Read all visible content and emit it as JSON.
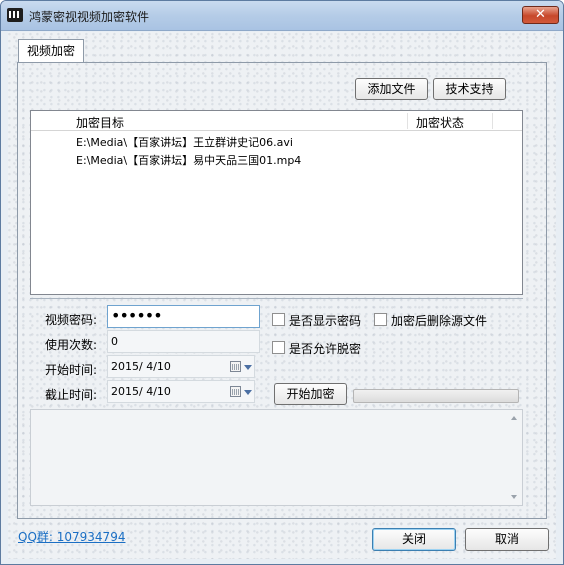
{
  "window": {
    "title": "鸿蒙密视视频加密软件",
    "close_glyph": "✕"
  },
  "tab": {
    "label": "视频加密"
  },
  "toolbar": {
    "add_file_label": "添加文件",
    "support_label": "技术支持"
  },
  "list": {
    "columns": [
      "加密目标",
      "加密状态"
    ],
    "rows": [
      {
        "target": "E:\\Media\\【百家讲坛】王立群讲史记06.avi",
        "status": ""
      },
      {
        "target": "E:\\Media\\【百家讲坛】易中天品三国01.mp4",
        "status": ""
      }
    ]
  },
  "form": {
    "password_label": "视频密码:",
    "password_value": "••••••",
    "usage_label": "使用次数:",
    "usage_value": "0",
    "start_label": "开始时间:",
    "start_value": "2015/  4/10",
    "end_label": "截止时间:",
    "end_value": "2015/  4/10",
    "show_password_label": "是否显示密码",
    "delete_source_label": "加密后删除源文件",
    "allow_decrypt_label": "是否允许脱密",
    "start_encrypt_label": "开始加密"
  },
  "footer": {
    "qq_label": "QQ群: 107934794",
    "close_label": "关闭",
    "cancel_label": "取消"
  }
}
